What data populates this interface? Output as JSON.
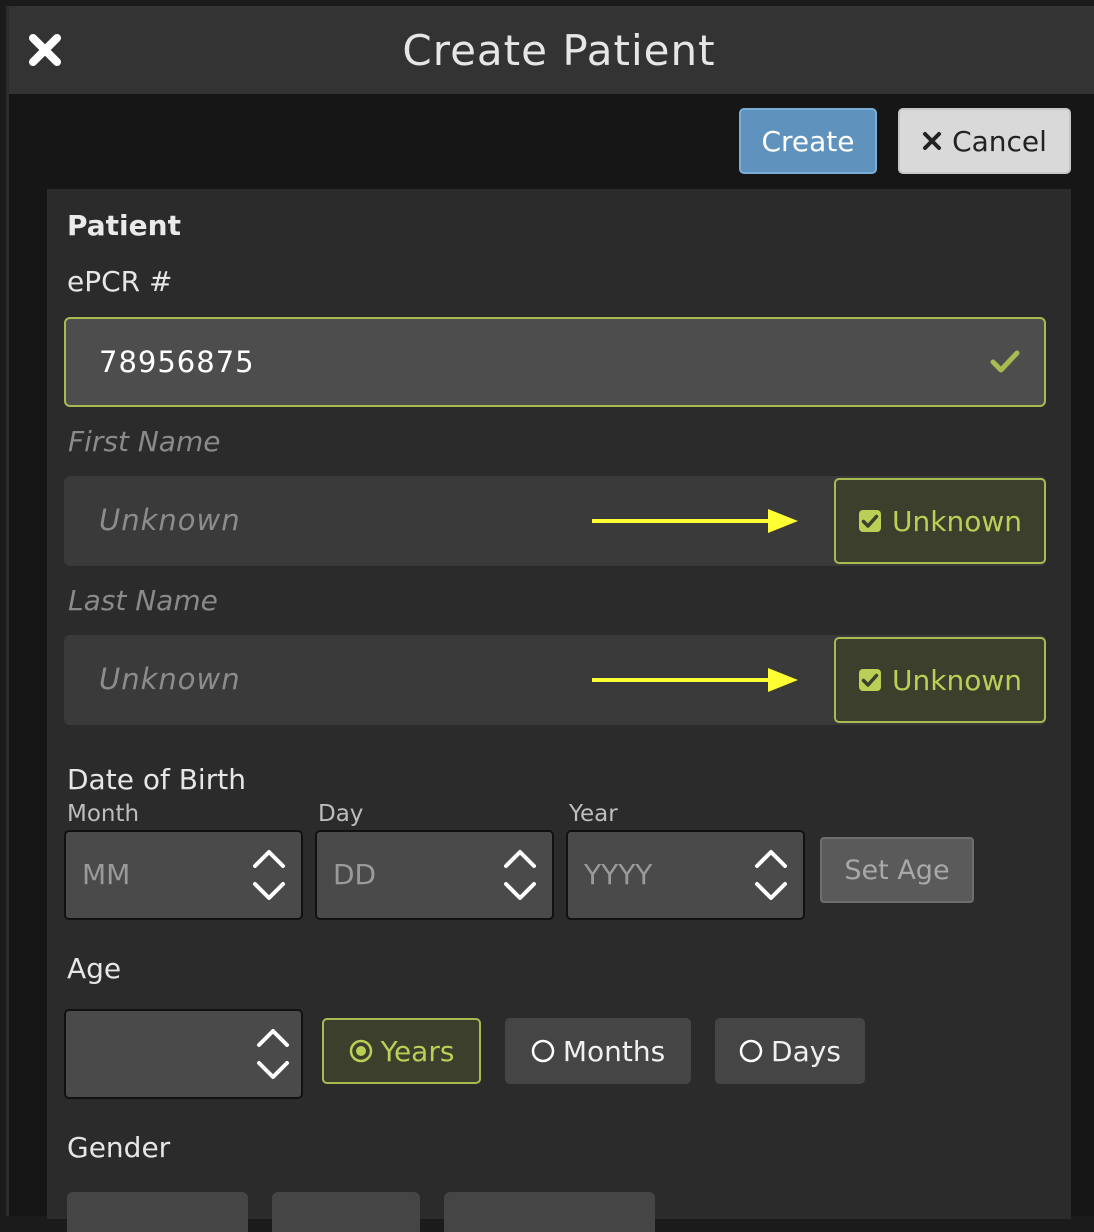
{
  "window": {
    "title": "Create Patient"
  },
  "toolbar": {
    "create_label": "Create",
    "cancel_label": "Cancel"
  },
  "patient": {
    "section_title": "Patient",
    "epcr_label": "ePCR #",
    "epcr_value": "78956875",
    "first_name_label": "First Name",
    "first_name_placeholder": "Unknown",
    "first_name_unknown_label": "Unknown",
    "first_name_unknown_checked": true,
    "last_name_label": "Last Name",
    "last_name_placeholder": "Unknown",
    "last_name_unknown_label": "Unknown",
    "last_name_unknown_checked": true
  },
  "dob": {
    "label": "Date of Birth",
    "month_label": "Month",
    "month_placeholder": "MM",
    "day_label": "Day",
    "day_placeholder": "DD",
    "year_label": "Year",
    "year_placeholder": "YYYY",
    "set_age_label": "Set Age"
  },
  "age": {
    "label": "Age",
    "value": "",
    "units": [
      {
        "label": "Years",
        "selected": true
      },
      {
        "label": "Months",
        "selected": false
      },
      {
        "label": "Days",
        "selected": false
      }
    ]
  },
  "gender": {
    "label": "Gender"
  },
  "colors": {
    "accent_green": "#a6bb52",
    "primary_blue": "#5f93bd",
    "annotation_arrow": "#ffff33"
  },
  "icons": {
    "close": "close-icon",
    "cancel": "times-icon",
    "valid": "check-icon",
    "checkbox": "checkbox-checked-icon",
    "spinner": "spinner-arrows-icon",
    "radio_selected": "radio-selected-icon",
    "radio_empty": "radio-empty-icon"
  }
}
